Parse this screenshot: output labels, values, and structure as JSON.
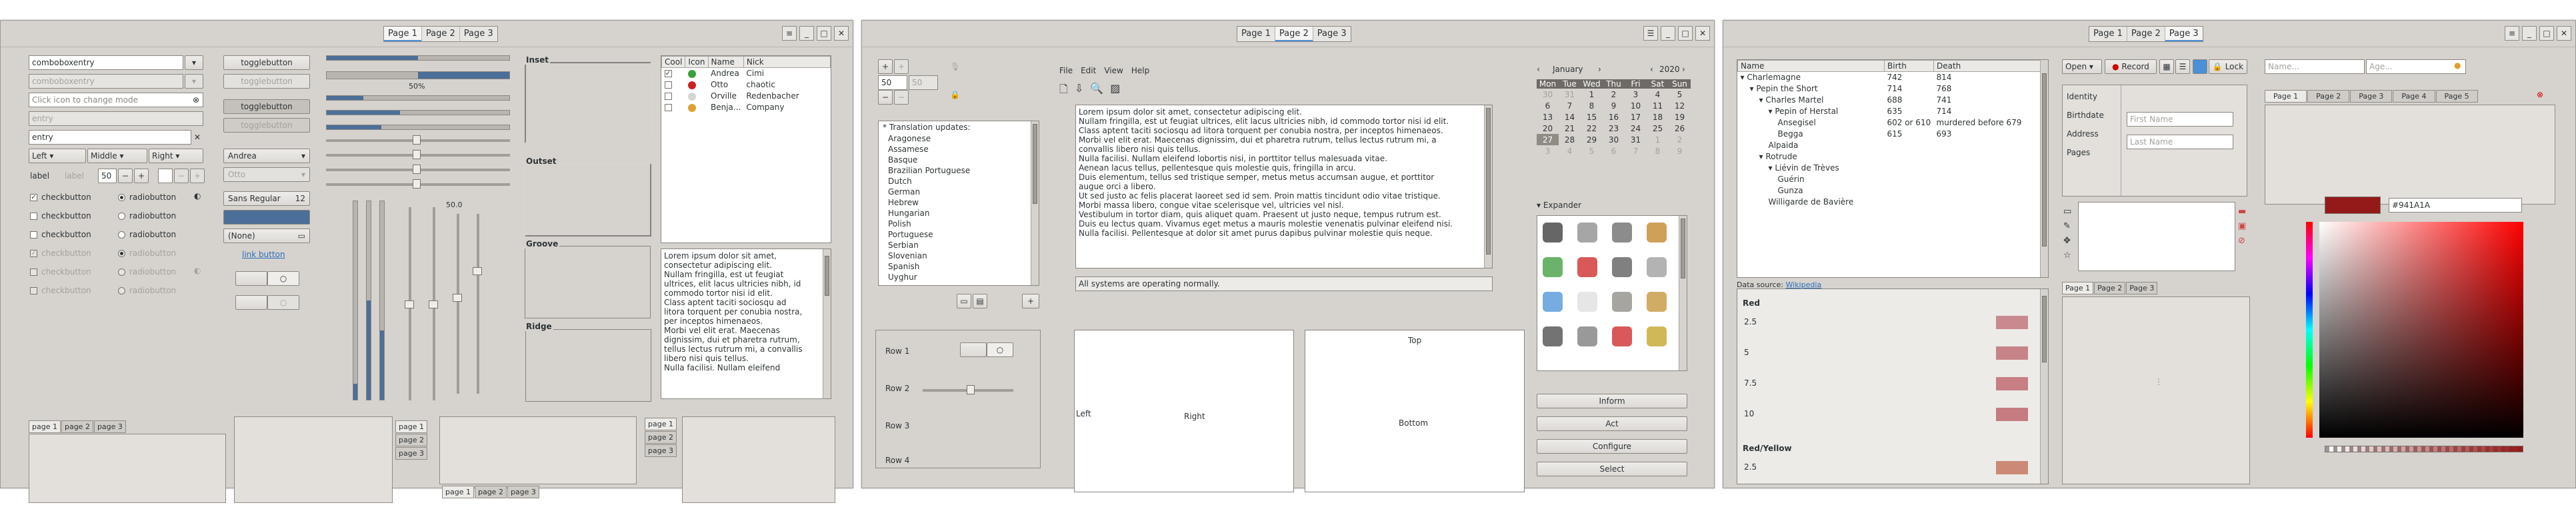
{
  "window1": {
    "stack": [
      "Page 1",
      "Page 2",
      "Page 3"
    ],
    "controls": [
      "≡",
      "_",
      "□",
      "✕"
    ],
    "combo1_value": "comboboxentry",
    "combo2_value": "comboboxentry",
    "search_placeholder": "Click icon to change mode",
    "entry_disabled": "entry",
    "entry_value": "entry",
    "align": [
      "Left",
      "Middle",
      "Right"
    ],
    "label_text": "label",
    "label_disabled": "label",
    "spin_value": "50",
    "checks": [
      "checkbutton",
      "checkbutton",
      "checkbutton",
      "checkbutton",
      "checkbutton",
      "checkbutton"
    ],
    "radios": [
      "radiobutton",
      "radiobutton",
      "radiobutton",
      "radiobutton",
      "radiobutton",
      "radiobutton"
    ],
    "toggles": [
      "togglebutton",
      "togglebutton",
      "togglebutton",
      "togglebutton"
    ],
    "combo_andrea": "Andrea",
    "combo_otto": "Otto",
    "font_button": "Sans Regular",
    "font_size": "12",
    "none_combo": "(None)",
    "link_button": "link button",
    "progress_label": "50%",
    "scale_value": "50.0",
    "frames": [
      "Inset",
      "Outset",
      "Groove",
      "Ridge"
    ],
    "tree_headers": [
      "Cool",
      "Icon",
      "Name",
      "Nick"
    ],
    "tree_rows": [
      {
        "cool": "✓",
        "name": "Andrea",
        "nick": "Cimi",
        "color": "#3aa13a"
      },
      {
        "cool": "",
        "name": "Otto",
        "nick": "chaotic",
        "color": "#cc2222"
      },
      {
        "cool": "",
        "name": "Orville",
        "nick": "Redenbacher",
        "color": "#d8d4cf"
      },
      {
        "cool": "●",
        "name": "Benja...",
        "nick": "Company",
        "color": "#e0a030"
      }
    ],
    "lorem": "Lorem ipsum dolor sit amet,\nconsectetur adipiscing elit.\nNullam fringilla, est ut feugiat\nultrices, elit lacus ultricies nibh, id\ncommodo tortor nisi id elit.\nClass aptent taciti sociosqu ad\nlitora torquent per conubia nostra,\nper inceptos himenaeos.\nMorbi vel elit erat. Maecenas\ndignissim, dui et pharetra rutrum,\ntellus lectus rutrum mi, a convallis\nlibero nisi quis tellus.\nNulla facilisi. Nullam eleifend",
    "tabs_a": [
      "page 1",
      "page 2",
      "page 3"
    ],
    "tabs_b": [
      "page 1",
      "page 2",
      "page 3"
    ],
    "tabs_c": [
      "page 1",
      "page 2",
      "page 3"
    ],
    "tabs_d": [
      "page 1",
      "page 2",
      "page 3"
    ]
  },
  "window2": {
    "stack": [
      "Page 1",
      "Page 2",
      "Page 3"
    ],
    "controls": [
      "☰",
      "_",
      "□",
      "✕"
    ],
    "spin1": "50",
    "spin2": "50",
    "languages_title": "* Translation updates:",
    "languages": [
      "Aragonese",
      "Assamese",
      "Basque",
      "Brazilian Portuguese",
      "Dutch",
      "German",
      "Hebrew",
      "Hungarian",
      "Polish",
      "Portuguese",
      "Serbian",
      "Slovenian",
      "Spanish",
      "Uyghur"
    ],
    "menu": [
      "File",
      "Edit",
      "View",
      "Help"
    ],
    "editor_text": "Lorem ipsum dolor sit amet, consectetur adipiscing elit.\nNullam fringilla, est ut feugiat ultrices, elit lacus ultricies nibh, id commodo tortor nisi id elit.\nClass aptent taciti sociosqu ad litora torquent per conubia nostra, per inceptos himenaeos.\nMorbi vel elit erat. Maecenas dignissim, dui et pharetra rutrum, tellus lectus rutrum mi, a\nconvallis libero nisi quis tellus.\nNulla facilisi. Nullam eleifend lobortis nisi, in porttitor tellus malesuada vitae.\nAenean lacus tellus, pellentesque quis molestie quis, fringilla in arcu.\nDuis elementum, tellus sed tristique semper, metus metus accumsan augue, et porttitor\naugue orci a libero.\nUt sed justo ac felis placerat laoreet sed id sem. Proin mattis tincidunt odio vitae tristique.\nMorbi massa libero, congue vitae scelerisque vel, ultricies vel nisl.\nVestibulum in tortor diam, quis aliquet quam. Praesent ut justo neque, tempus rutrum est.\nDuis eu lectus quam. Vivamus eget metus a mauris molestie venenatis pulvinar eleifend nisi.\nNulla facilisi. Pellentesque at dolor sit amet purus dapibus pulvinar molestie quis neque.",
    "status": "All systems are operating normally.",
    "calendar_month": "January",
    "calendar_year": "2020",
    "calendar_days": [
      "Mon",
      "Tue",
      "Wed",
      "Thu",
      "Fri",
      "Sat",
      "Sun"
    ],
    "calendar_weeks": [
      [
        "30",
        "31",
        "1",
        "2",
        "3",
        "4",
        "5"
      ],
      [
        "6",
        "7",
        "8",
        "9",
        "10",
        "11",
        "12"
      ],
      [
        "13",
        "14",
        "15",
        "16",
        "17",
        "18",
        "19"
      ],
      [
        "20",
        "21",
        "22",
        "23",
        "24",
        "25",
        "26"
      ],
      [
        "27",
        "28",
        "29",
        "30",
        "31",
        "1",
        "2"
      ],
      [
        "3",
        "4",
        "5",
        "6",
        "7",
        "8",
        "9"
      ]
    ],
    "expander": "Expander",
    "rows": [
      "Row 1",
      "Row 2",
      "Row 3",
      "Row 4"
    ],
    "pos_top": "Top",
    "pos_left": "Left",
    "pos_right": "Right",
    "pos_bottom": "Bottom",
    "action_buttons": [
      "Inform",
      "Act",
      "Configure",
      "Select"
    ]
  },
  "window3": {
    "stack": [
      "Page 1",
      "Page 2",
      "Page 3"
    ],
    "controls": [
      "≡",
      "_",
      "□",
      "✕"
    ],
    "tree_headers": [
      "Name",
      "Birth",
      "Death"
    ],
    "tree_rows": [
      {
        "name": "▾ Charlemagne",
        "birth": "742",
        "death": "814",
        "indent": 0
      },
      {
        "name": "▾ Pepin the Short",
        "birth": "714",
        "death": "768",
        "indent": 1
      },
      {
        "name": "▾ Charles Martel",
        "birth": "688",
        "death": "741",
        "indent": 2
      },
      {
        "name": "▾ Pepin of Herstal",
        "birth": "635",
        "death": "714",
        "indent": 3
      },
      {
        "name": "Ansegisel",
        "birth": "602 or 610",
        "death": "murdered before 679",
        "indent": 4
      },
      {
        "name": "Begga",
        "birth": "615",
        "death": "693",
        "indent": 4
      },
      {
        "name": "Alpaida",
        "birth": "",
        "death": "",
        "indent": 3
      },
      {
        "name": "▾ Rotrude",
        "birth": "",
        "death": "",
        "indent": 2
      },
      {
        "name": "▾ Liévin de Trèves",
        "birth": "",
        "death": "",
        "indent": 3
      },
      {
        "name": "Guérin",
        "birth": "",
        "death": "",
        "indent": 4
      },
      {
        "name": "Gunza",
        "birth": "",
        "death": "",
        "indent": 4
      },
      {
        "name": "Willigarde de Bavière",
        "birth": "",
        "death": "",
        "indent": 3
      }
    ],
    "data_source_label": "Data source:",
    "data_source_link": "Wikipedia",
    "color_sections": [
      {
        "title": "Red",
        "items": [
          {
            "v": "2.5",
            "c": "#c98a8f"
          },
          {
            "v": "5",
            "c": "#c78488"
          },
          {
            "v": "7.5",
            "c": "#c77f83"
          },
          {
            "v": "10",
            "c": "#c57b7f"
          }
        ]
      },
      {
        "title": "Red/Yellow",
        "items": [
          {
            "v": "2.5",
            "c": "#cc8a76"
          }
        ]
      }
    ],
    "open_button": "Open",
    "record_button": "Record",
    "lock_button": "Lock",
    "sidebar_items": [
      "Identity",
      "Birthdate",
      "Address",
      "Pages"
    ],
    "first_name": "First Name",
    "last_name": "Last Name",
    "small_tabs": [
      "Page 1",
      "Page 2",
      "Page 3"
    ],
    "name_placeholder": "Name...",
    "age_placeholder": "Age...",
    "right_tabs": [
      "Page 1",
      "Page 2",
      "Page 3",
      "Page 4",
      "Page 5"
    ],
    "hex_value": "#941A1A",
    "selected_color": "#941A1A"
  }
}
